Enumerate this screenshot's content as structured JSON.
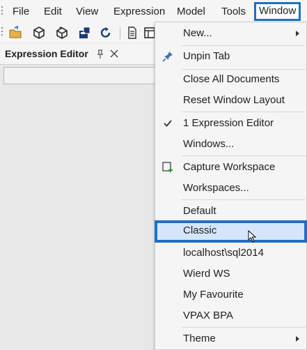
{
  "menubar": {
    "items": [
      "File",
      "Edit",
      "View",
      "Expression",
      "Model",
      "Tools",
      "Window"
    ],
    "active_item": "Window"
  },
  "toolbar": {
    "icons": [
      "open-folder-icon",
      "cube-icon",
      "cube-open-icon",
      "save-icon",
      "refresh-icon",
      "document-icon",
      "grid-document-icon"
    ]
  },
  "panel": {
    "title": "Expression Editor",
    "input_value": ""
  },
  "window_menu": {
    "items": [
      {
        "label": "New...",
        "submenu": true
      },
      {
        "label": "Unpin Tab",
        "icon": "pin-icon"
      },
      {
        "label": "Close All Documents"
      },
      {
        "label": "Reset Window Layout"
      },
      {
        "label": "1 Expression Editor",
        "checked": true
      },
      {
        "label": "Windows..."
      },
      {
        "label": "Capture Workspace",
        "icon": "capture-workspace-icon"
      },
      {
        "label": "Workspaces..."
      },
      {
        "label": "Default"
      },
      {
        "label": "Classic",
        "highlighted": true
      },
      {
        "label": "localhost\\sql2014"
      },
      {
        "label": "Wierd WS"
      },
      {
        "label": "My Favourite"
      },
      {
        "label": "VPAX BPA"
      },
      {
        "label": "Theme",
        "submenu": true
      }
    ]
  },
  "colors": {
    "accent": "#1e6fc9",
    "highlight_bg": "#d5e6fb",
    "menu_bg": "#f5f5f5"
  }
}
